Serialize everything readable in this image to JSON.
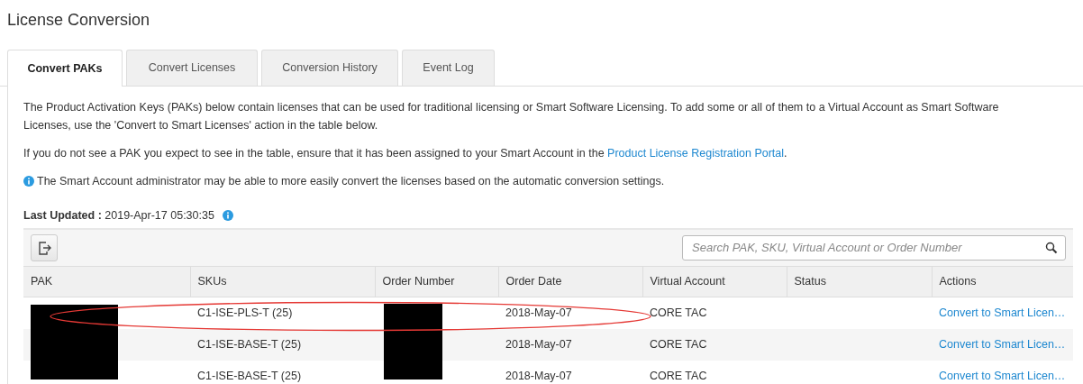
{
  "page_title": "License Conversion",
  "tabs": [
    {
      "label": "Convert PAKs",
      "selected": true
    },
    {
      "label": "Convert Licenses",
      "selected": false
    },
    {
      "label": "Conversion History",
      "selected": false
    },
    {
      "label": "Event Log",
      "selected": false
    }
  ],
  "intro": "The Product Activation Keys (PAKs) below contain licenses that can be used for traditional licensing or Smart Software Licensing. To add some or all of them to a Virtual Account as Smart Software Licenses, use the 'Convert to Smart Licenses' action in the table below.",
  "assign_note": {
    "text": "If you do not see a PAK you expect to see in the table, ensure that it has been assigned to your Smart Account in the ",
    "link": "Product License Registration Portal",
    "end": "."
  },
  "info_note": "The Smart Account administrator may be able to more easily convert the licenses based on the automatic conversion settings.",
  "last_updated": {
    "label": "Last Updated :",
    "value": "2019-Apr-17 05:30:35"
  },
  "search": {
    "placeholder": "Search PAK, SKU, Virtual Account or Order Number"
  },
  "table": {
    "columns": [
      "PAK",
      "SKUs",
      "Order Number",
      "Order Date",
      "Virtual Account",
      "Status",
      "Actions"
    ],
    "rows": [
      {
        "sku": "C1-ISE-PLS-T (25)",
        "order_date": "2018-May-07",
        "virtual_account": "CORE TAC",
        "action": "Convert to Smart Licen…",
        "highlighted": true
      },
      {
        "sku": "C1-ISE-BASE-T (25)",
        "order_date": "2018-May-07",
        "virtual_account": "CORE TAC",
        "action": "Convert to Smart Licen…",
        "highlighted": false
      },
      {
        "sku": "C1-ISE-BASE-T (25)",
        "order_date": "2018-May-07",
        "virtual_account": "CORE TAC",
        "action": "Convert to Smart Licen…",
        "highlighted": false
      }
    ]
  }
}
